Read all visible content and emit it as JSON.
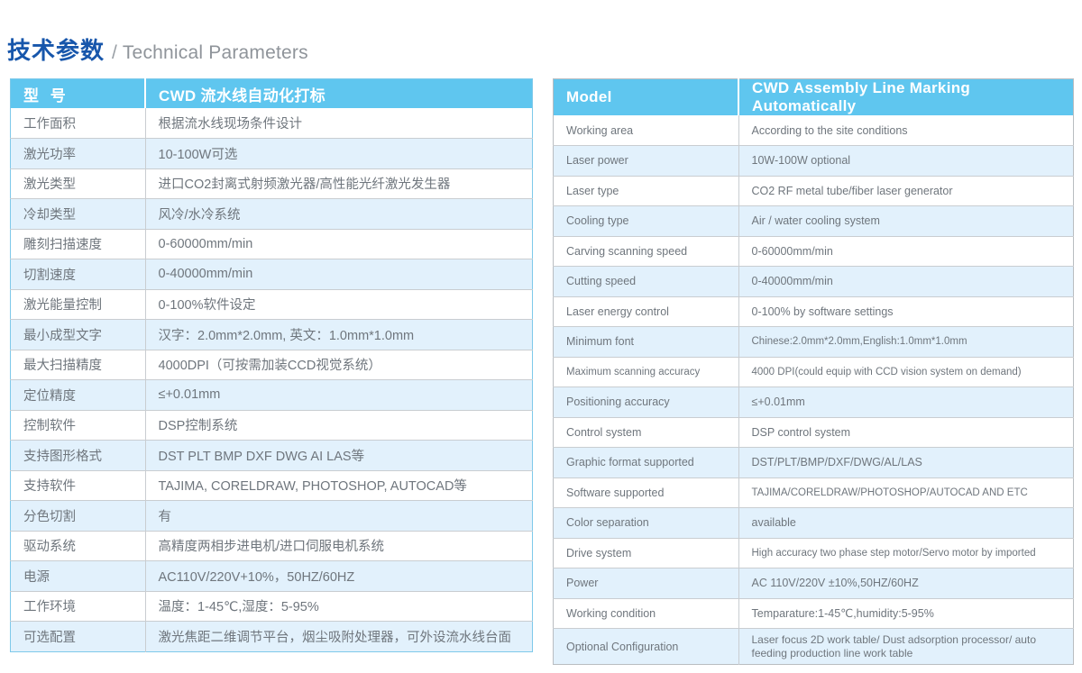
{
  "page": {
    "title_cn": "技术参数",
    "title_separator": "/",
    "title_en": "Technical Parameters"
  },
  "colors": {
    "header_blue": "#5fc6ef",
    "row_alt_blue": "#e2f1fc",
    "title_blue": "#1756ab",
    "title_gray": "#8f949a",
    "body_text": "#6f767d",
    "left_border": "#7ec9ea",
    "right_border": "#b9bdc1"
  },
  "left_table": {
    "header": {
      "key": "型  号",
      "value": "CWD 流水线自动化打标"
    },
    "rows": [
      {
        "key": "工作面积",
        "value": "根据流水线现场条件设计"
      },
      {
        "key": "激光功率",
        "value": "10-100W可选"
      },
      {
        "key": "激光类型",
        "value": "进口CO2封离式射频激光器/高性能光纤激光发生器"
      },
      {
        "key": "冷却类型",
        "value": "风冷/水冷系统"
      },
      {
        "key": "雕刻扫描速度",
        "value": "0-60000mm/min"
      },
      {
        "key": "切割速度",
        "value": "0-40000mm/min"
      },
      {
        "key": "激光能量控制",
        "value": "0-100%软件设定"
      },
      {
        "key": "最小成型文字",
        "value": "汉字：2.0mm*2.0mm, 英文：1.0mm*1.0mm"
      },
      {
        "key": "最大扫描精度",
        "value": "4000DPI（可按需加装CCD视觉系统）"
      },
      {
        "key": "定位精度",
        "value": "≤+0.01mm"
      },
      {
        "key": "控制软件",
        "value": "DSP控制系统"
      },
      {
        "key": "支持图形格式",
        "value": "DST PLT BMP DXF DWG AI LAS等"
      },
      {
        "key": "支持软件",
        "value": "TAJIMA, CORELDRAW, PHOTOSHOP, AUTOCAD等"
      },
      {
        "key": "分色切割",
        "value": "有"
      },
      {
        "key": "驱动系统",
        "value": "高精度两相步进电机/进口伺服电机系统"
      },
      {
        "key": "电源",
        "value": "AC110V/220V+10%，50HZ/60HZ"
      },
      {
        "key": "工作环境",
        "value": "温度：1-45℃,湿度：5-95%"
      },
      {
        "key": "可选配置",
        "value": "激光焦距二维调节平台，烟尘吸附处理器，可外设流水线台面"
      }
    ]
  },
  "right_table": {
    "header": {
      "key": "Model",
      "value": "CWD Assembly Line Marking Automatically"
    },
    "rows": [
      {
        "key": "Working area",
        "value": "According to the site conditions"
      },
      {
        "key": "Laser power",
        "value": "10W-100W optional"
      },
      {
        "key": "Laser type",
        "value": "CO2 RF metal tube/fiber laser generator"
      },
      {
        "key": "Cooling type",
        "value": "Air / water cooling system"
      },
      {
        "key": "Carving scanning speed",
        "value": "0-60000mm/min"
      },
      {
        "key": "Cutting speed",
        "value": "0-40000mm/min"
      },
      {
        "key": "Laser energy control",
        "value": "0-100% by software settings"
      },
      {
        "key": "Minimum font",
        "value": "Chinese:2.0mm*2.0mm,English:1.0mm*1.0mm"
      },
      {
        "key": "Maximum scanning accuracy",
        "value": "4000 DPI(could equip with CCD vision system on demand)"
      },
      {
        "key": "Positioning accuracy",
        "value": "≤+0.01mm"
      },
      {
        "key": "Control system",
        "value": "DSP control system"
      },
      {
        "key": "Graphic format supported",
        "value": "DST/PLT/BMP/DXF/DWG/AL/LAS"
      },
      {
        "key": "Software supported",
        "value": "TAJIMA/CORELDRAW/PHOTOSHOP/AUTOCAD AND ETC"
      },
      {
        "key": "Color separation",
        "value": "available"
      },
      {
        "key": "Drive system",
        "value": "High accuracy two phase step motor/Servo motor by imported"
      },
      {
        "key": "Power",
        "value": "AC 110V/220V ±10%,50HZ/60HZ"
      },
      {
        "key": "Working condition",
        "value": "Temparature:1-45℃,humidity:5-95%"
      },
      {
        "key": "Optional Configuration",
        "value": "Laser focus 2D work table/ Dust adsorption processor/ auto feeding production line work table"
      }
    ]
  }
}
